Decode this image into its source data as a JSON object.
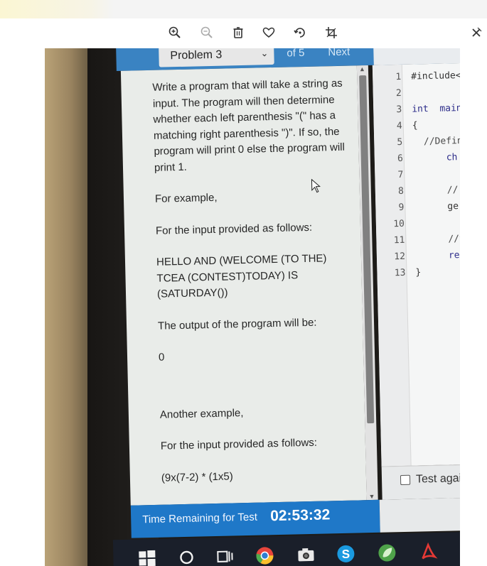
{
  "viewer": {
    "toolbar_icons": [
      "zoom-in-icon",
      "zoom-out-icon",
      "trash-icon",
      "heart-icon",
      "rotate-icon",
      "crop-icon",
      "close-icon"
    ]
  },
  "contest": {
    "problem_select": "Problem 3",
    "of_label": "of 5",
    "next_label": "Next",
    "problem_paragraphs": [
      "Write a program that will take a string as input. The program will then determine whether each left parenthesis \"(\" has a matching right parenthesis \")\". If so, the program will print 0 else the program will print 1.",
      "For example,",
      "For the input provided as follows:",
      "HELLO AND (WELCOME (TO THE) TCEA (CONTEST)TODAY) IS (SATURDAY())",
      "The output of the program will be:",
      "0",
      "Another example,",
      "For the input provided as follows:",
      "(9x(7-2) * (1x5)"
    ],
    "timer_label": "Time Remaining for Test",
    "timer_value": "02:53:32",
    "test_label": "Test against"
  },
  "editor": {
    "line_numbers": [
      "1",
      "2",
      "3",
      "4",
      "5",
      "6",
      "7",
      "8",
      "9",
      "10",
      "11",
      "12",
      "13"
    ],
    "code_lines": [
      "#include<s",
      "",
      "int  main(",
      "{",
      "  //Defini",
      "      ch",
      "",
      "      //",
      "      ge",
      "",
      "      //S",
      "      ret",
      "}"
    ]
  },
  "taskbar": {
    "icons": [
      "windows-start-icon",
      "cortana-search-icon",
      "task-view-icon",
      "chrome-icon",
      "camera-icon",
      "skype-icon",
      "app-leaf-icon",
      "acrobat-icon"
    ]
  },
  "colors": {
    "accent_blue": "#3a83c2",
    "timer_blue": "#1f78c8",
    "pane_bg": "#e9ece9",
    "taskbar": "#1a1f2a"
  }
}
